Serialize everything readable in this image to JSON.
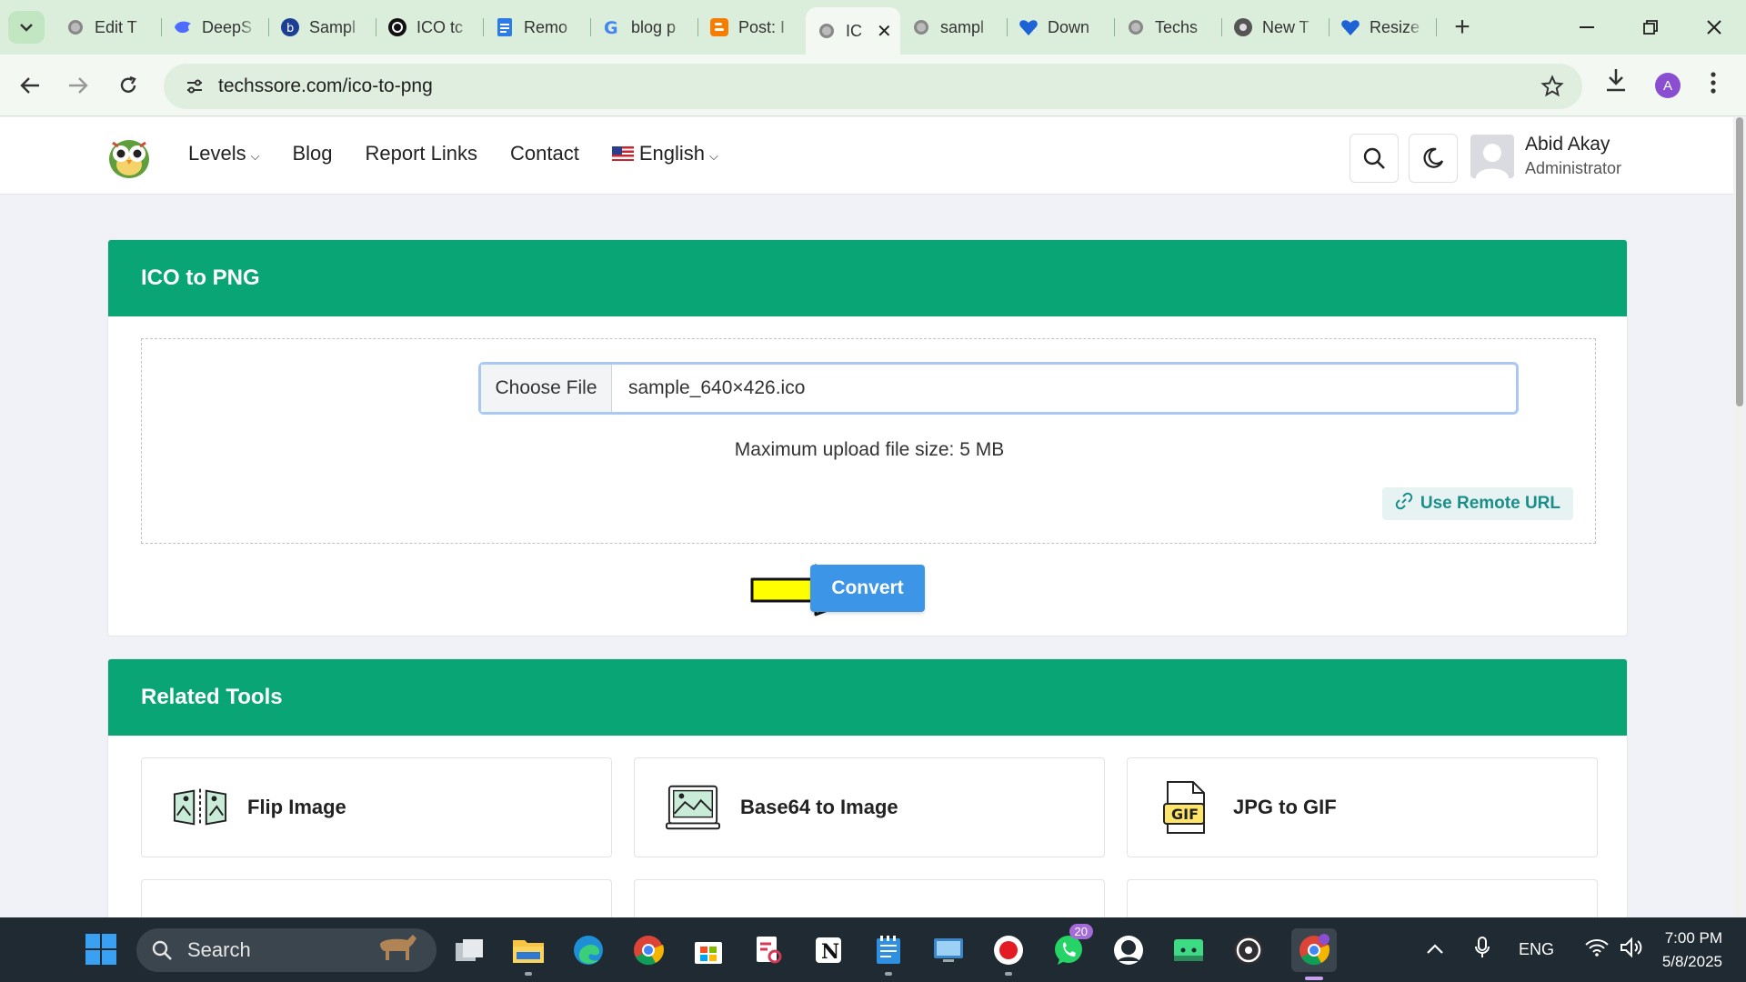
{
  "browser": {
    "tabs": [
      {
        "label": "Edit T",
        "icon": "globe-icon"
      },
      {
        "label": "DeepS",
        "icon": "deepseek-icon"
      },
      {
        "label": "Sampl",
        "icon": "bing-icon"
      },
      {
        "label": "ICO tc",
        "icon": "openai-icon"
      },
      {
        "label": "Remo",
        "icon": "docs-icon"
      },
      {
        "label": "blog p",
        "icon": "google-icon"
      },
      {
        "label": "Post: I",
        "icon": "blogger-icon"
      },
      {
        "label": "IC",
        "icon": "globe-icon",
        "active": true
      },
      {
        "label": "sampl",
        "icon": "globe-icon"
      },
      {
        "label": "Down",
        "icon": "heart-icon"
      },
      {
        "label": "Techs",
        "icon": "globe-icon"
      },
      {
        "label": "New T",
        "icon": "chrome-icon"
      },
      {
        "label": "Resize",
        "icon": "heart-icon"
      }
    ],
    "url": "techssore.com/ico-to-png",
    "profile_initial": "A"
  },
  "site": {
    "nav": {
      "levels": "Levels",
      "blog": "Blog",
      "report_links": "Report Links",
      "contact": "Contact",
      "language": "English"
    },
    "user": {
      "name": "Abid Akay",
      "role": "Administrator"
    }
  },
  "converter": {
    "title": "ICO to PNG",
    "choose_file": "Choose File",
    "file_name": "sample_640×426.ico",
    "max_size": "Maximum upload file size: 5 MB",
    "remote_url": "Use Remote URL",
    "convert": "Convert"
  },
  "related": {
    "title": "Related Tools",
    "tools": [
      {
        "label": "Flip Image",
        "icon": "flip-image-icon"
      },
      {
        "label": "Base64 to Image",
        "icon": "base64-image-icon"
      },
      {
        "label": "JPG to GIF",
        "icon": "gif-file-icon"
      }
    ]
  },
  "taskbar": {
    "search_placeholder": "Search",
    "whatsapp_badge": "20",
    "language": "ENG",
    "time": "7:00 PM",
    "date": "5/8/2025"
  },
  "colors": {
    "accent_green": "#0aa574",
    "convert_blue": "#3c95e6",
    "arrow_yellow": "#ffff00"
  }
}
